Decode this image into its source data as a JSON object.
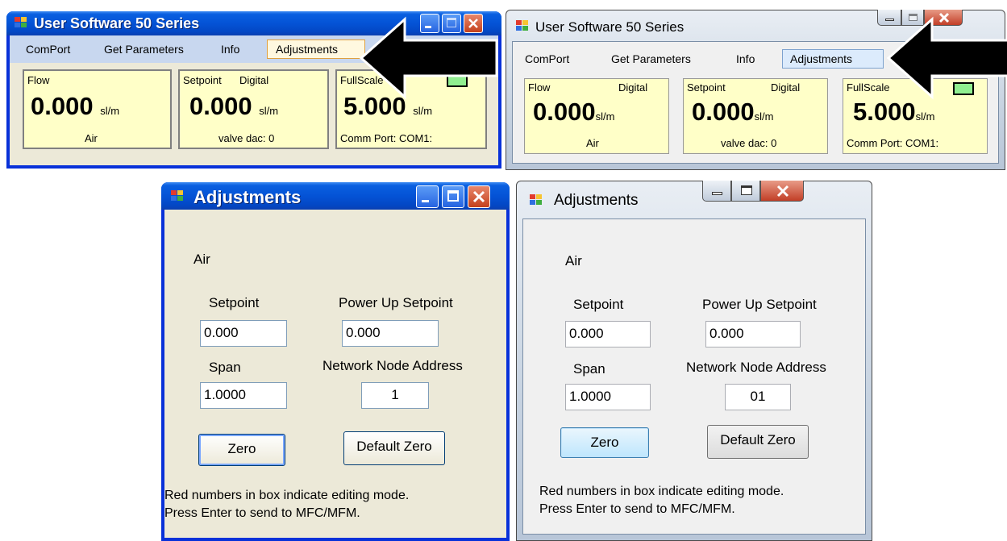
{
  "main_window": {
    "title": "User Software 50 Series",
    "menu": [
      "ComPort",
      "Get Parameters",
      "Info",
      "Adjustments"
    ],
    "flow_panel": {
      "label": "Flow",
      "mode": "Digital",
      "value": "0.000",
      "unit": "sl/m",
      "gas": "Air"
    },
    "setpoint_panel": {
      "label": "Setpoint",
      "mode": "Digital",
      "value": "0.000",
      "unit": "sl/m",
      "valve": "valve dac: 0"
    },
    "fullscale_panel": {
      "label": "FullScale",
      "value": "5.000",
      "unit": "sl/m",
      "comm_label": "Comm Port:",
      "comm_value": "COM1:"
    }
  },
  "adjustments_window": {
    "title": "Adjustments",
    "gas": "Air",
    "setpoint_label": "Setpoint",
    "setpoint_value": "0.000",
    "power_up_label": "Power Up Setpoint",
    "power_up_value": "0.000",
    "span_label": "Span",
    "span_value": "1.0000",
    "node_label": "Network Node Address",
    "node_value_xp": "1",
    "node_value_7": "01",
    "zero_button": "Zero",
    "default_zero_button": "Default Zero",
    "note_line1": "Red numbers in box indicate editing mode.",
    "note_line2": "Press Enter to send to MFC/MFM."
  },
  "colors": {
    "xp_title": "#0453d6",
    "panel_bg": "#ffffc8",
    "led": "#90ee90",
    "menu_highlight": "#c2d8f8"
  },
  "icons": [
    "app-icon",
    "minimize-icon",
    "maximize-icon",
    "close-icon",
    "pointer-arrow"
  ]
}
